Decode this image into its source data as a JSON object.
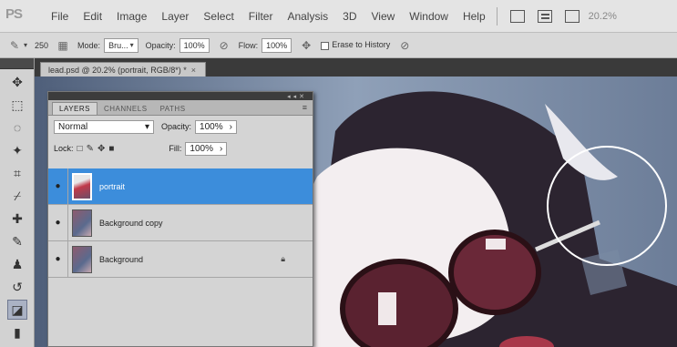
{
  "app": {
    "logo": "PS"
  },
  "menu": [
    "File",
    "Edit",
    "Image",
    "Layer",
    "Select",
    "Filter",
    "Analysis",
    "3D",
    "View",
    "Window",
    "Help"
  ],
  "menubar_zoom": "20.2%",
  "options": {
    "brush_size": "250",
    "mode_label": "Mode:",
    "mode_value": "Bru...",
    "opacity_label": "Opacity:",
    "opacity_value": "100%",
    "flow_label": "Flow:",
    "flow_value": "100%",
    "erase_history_label": "Erase to History"
  },
  "document": {
    "tab_title": "lead.psd @ 20.2% (portrait, RGB/8*) *",
    "close": "×"
  },
  "layers_panel": {
    "tabs": [
      "LAYERS",
      "CHANNELS",
      "PATHS"
    ],
    "active_tab": "LAYERS",
    "blend_mode": "Normal",
    "opacity_label": "Opacity:",
    "opacity_value": "100%",
    "lock_label": "Lock:",
    "fill_label": "Fill:",
    "fill_value": "100%",
    "layers": [
      {
        "name": "portrait",
        "selected": true,
        "locked": false
      },
      {
        "name": "Background copy",
        "selected": false,
        "locked": false
      },
      {
        "name": "Background",
        "selected": false,
        "locked": true
      }
    ]
  },
  "colors": {
    "selection": "#3c8ddb",
    "panel": "#d4d4d4",
    "menubar": "#e4e4e4"
  },
  "icons": [
    "brush-icon",
    "move-icon",
    "marquee-icon",
    "lasso-icon",
    "magic-wand-icon",
    "crop-icon",
    "eyedropper-icon",
    "healing-brush-icon",
    "brush-tool-icon",
    "clone-stamp-icon",
    "history-brush-icon",
    "eraser-icon",
    "gradient-icon",
    "eye-icon",
    "lock-icon"
  ]
}
